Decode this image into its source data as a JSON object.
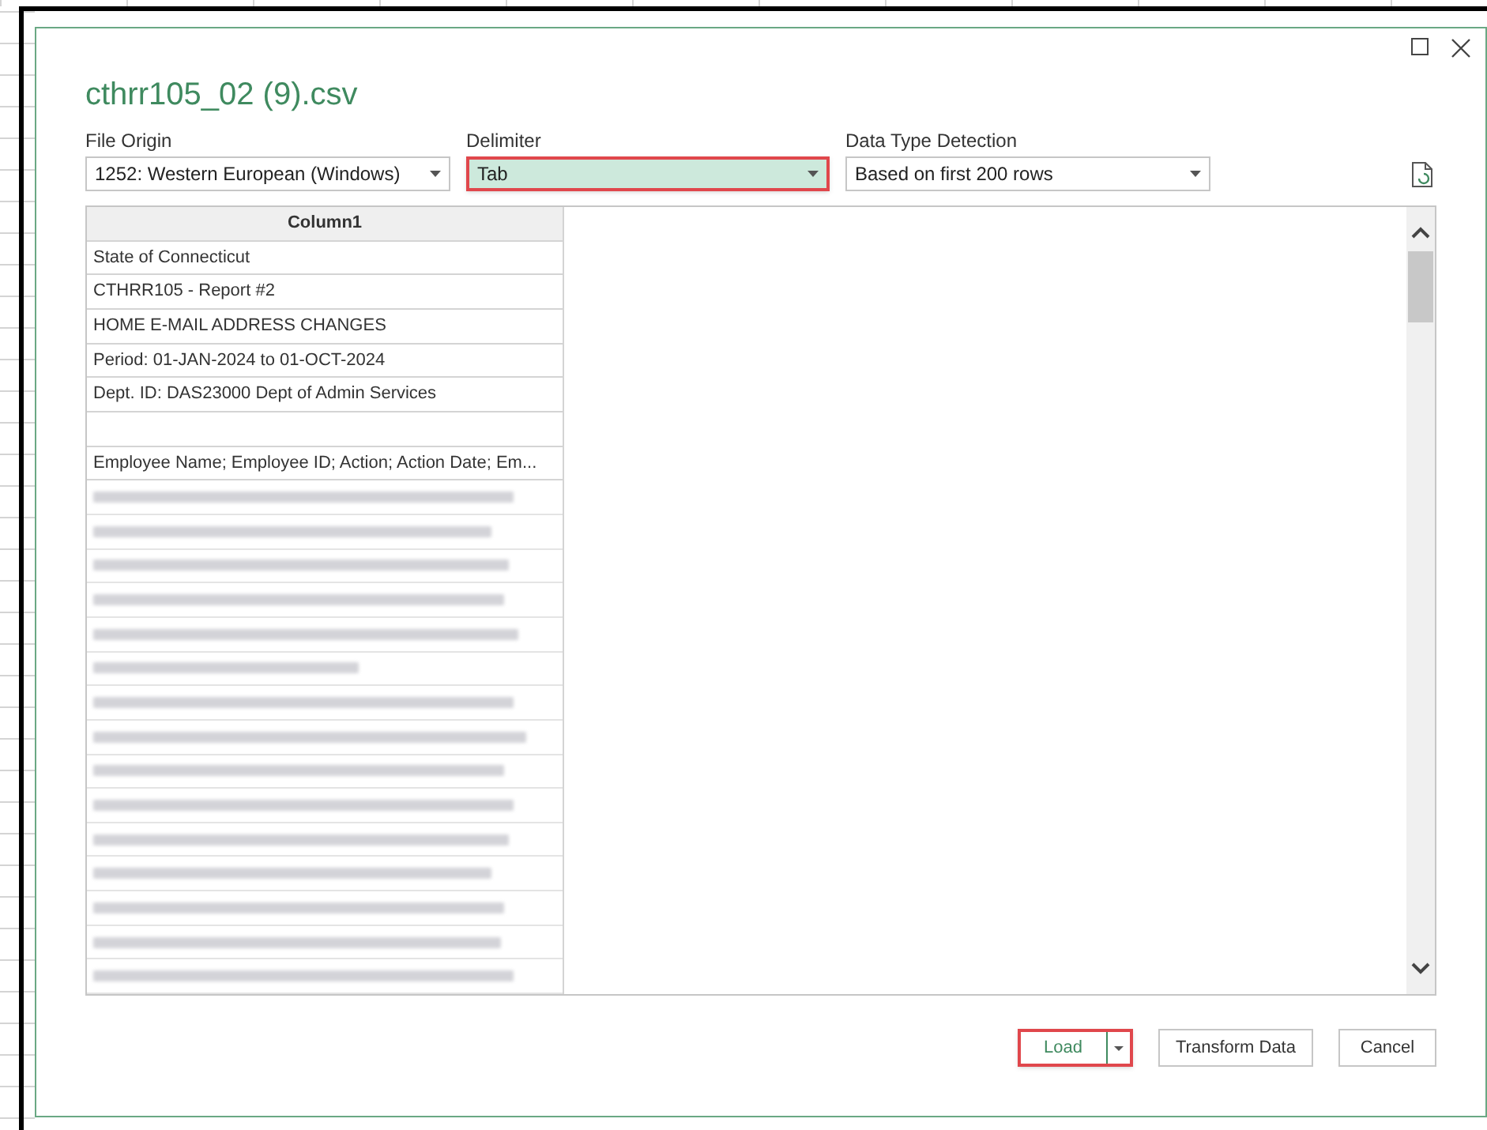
{
  "dialog": {
    "title": "cthrr105_02 (9).csv",
    "controls": [
      {
        "label": "File Origin",
        "value": "1252: Western European (Windows)",
        "highlighted": false
      },
      {
        "label": "Delimiter",
        "value": "Tab",
        "highlighted": true
      },
      {
        "label": "Data Type Detection",
        "value": "Based on first 200 rows",
        "highlighted": false
      }
    ],
    "table": {
      "columns": [
        "Column1"
      ],
      "rows": [
        "State of Connecticut",
        "CTHRR105 - Report #2",
        "HOME E-MAIL ADDRESS CHANGES",
        "Period: 01-JAN-2024 to 01-OCT-2024",
        "Dept. ID: DAS23000 Dept of Admin Services",
        "",
        "Employee Name; Employee ID; Action; Action Date; Em..."
      ]
    },
    "buttons": [
      {
        "label": "Load",
        "kind": "split",
        "highlighted": true
      },
      {
        "label": "Transform Data",
        "kind": "plain",
        "highlighted": false
      },
      {
        "label": "Cancel",
        "kind": "plain",
        "highlighted": false
      }
    ]
  }
}
